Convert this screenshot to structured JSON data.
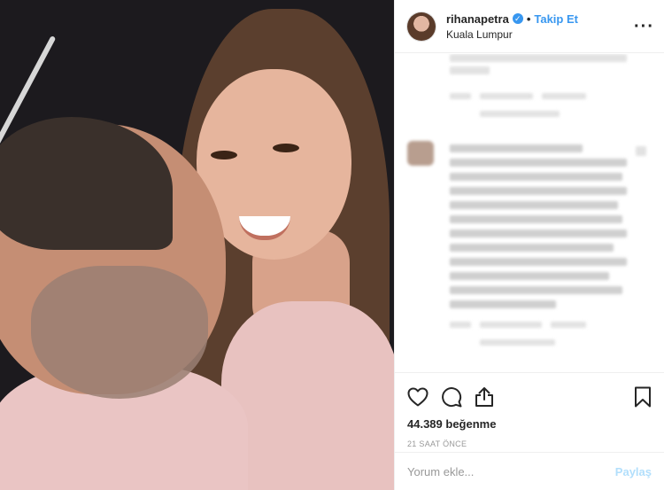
{
  "header": {
    "username": "rihanapetra",
    "separator": "•",
    "follow_label": "Takip Et",
    "location": "Kuala Lumpur",
    "verified_icon": "verified-badge-icon",
    "more_icon": "more-options-icon",
    "verified_color": "#3897f0"
  },
  "actions": {
    "like_icon": "heart-icon",
    "comment_icon": "comment-icon",
    "share_icon": "share-icon",
    "save_icon": "bookmark-icon"
  },
  "likes": {
    "text": "44.389 beğenme"
  },
  "timestamp": "21 SAAT ÖNCE",
  "add_comment": {
    "placeholder": "Yorum ekle...",
    "post_label": "Paylaş",
    "post_color": "#b2dffc"
  }
}
